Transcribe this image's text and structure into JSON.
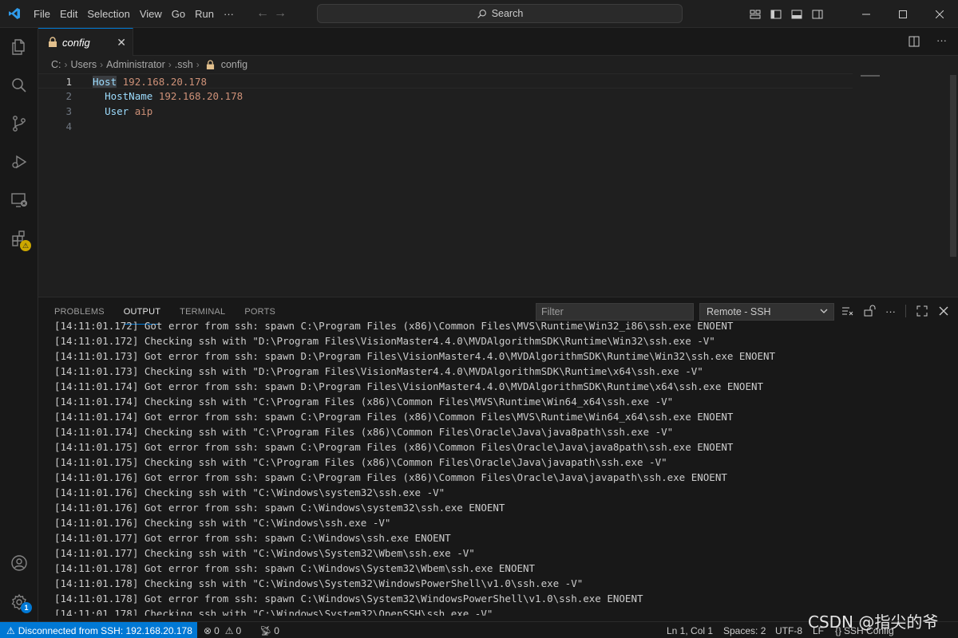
{
  "menu": [
    "File",
    "Edit",
    "Selection",
    "View",
    "Go",
    "Run",
    "···"
  ],
  "search": {
    "placeholder": "Search"
  },
  "tab": {
    "name": "config"
  },
  "breadcrumb": [
    "C:",
    "Users",
    "Administrator",
    ".ssh",
    "config"
  ],
  "editor": {
    "lines": [
      {
        "num": "1",
        "key": "Host",
        "value": "192.168.20.178",
        "indent": ""
      },
      {
        "num": "2",
        "key": "HostName",
        "value": "192.168.20.178",
        "indent": "  "
      },
      {
        "num": "3",
        "key": "User",
        "value": "aip",
        "indent": "  "
      },
      {
        "num": "4",
        "key": "",
        "value": "",
        "indent": ""
      }
    ]
  },
  "panel": {
    "tabs": [
      "PROBLEMS",
      "OUTPUT",
      "TERMINAL",
      "PORTS"
    ],
    "active_tab": "OUTPUT",
    "filter_placeholder": "Filter",
    "channel": "Remote - SSH",
    "log": [
      "[14:11:01.172] Got error from ssh: spawn C:\\Program Files (x86)\\Common Files\\MVS\\Runtime\\Win32_i86\\ssh.exe ENOENT",
      "[14:11:01.172] Checking ssh with \"D:\\Program Files\\VisionMaster4.4.0\\MVDAlgorithmSDK\\Runtime\\Win32\\ssh.exe -V\"",
      "[14:11:01.173] Got error from ssh: spawn D:\\Program Files\\VisionMaster4.4.0\\MVDAlgorithmSDK\\Runtime\\Win32\\ssh.exe ENOENT",
      "[14:11:01.173] Checking ssh with \"D:\\Program Files\\VisionMaster4.4.0\\MVDAlgorithmSDK\\Runtime\\x64\\ssh.exe -V\"",
      "[14:11:01.174] Got error from ssh: spawn D:\\Program Files\\VisionMaster4.4.0\\MVDAlgorithmSDK\\Runtime\\x64\\ssh.exe ENOENT",
      "[14:11:01.174] Checking ssh with \"C:\\Program Files (x86)\\Common Files\\MVS\\Runtime\\Win64_x64\\ssh.exe -V\"",
      "[14:11:01.174] Got error from ssh: spawn C:\\Program Files (x86)\\Common Files\\MVS\\Runtime\\Win64_x64\\ssh.exe ENOENT",
      "[14:11:01.174] Checking ssh with \"C:\\Program Files (x86)\\Common Files\\Oracle\\Java\\java8path\\ssh.exe -V\"",
      "[14:11:01.175] Got error from ssh: spawn C:\\Program Files (x86)\\Common Files\\Oracle\\Java\\java8path\\ssh.exe ENOENT",
      "[14:11:01.175] Checking ssh with \"C:\\Program Files (x86)\\Common Files\\Oracle\\Java\\javapath\\ssh.exe -V\"",
      "[14:11:01.176] Got error from ssh: spawn C:\\Program Files (x86)\\Common Files\\Oracle\\Java\\javapath\\ssh.exe ENOENT",
      "[14:11:01.176] Checking ssh with \"C:\\Windows\\system32\\ssh.exe -V\"",
      "[14:11:01.176] Got error from ssh: spawn C:\\Windows\\system32\\ssh.exe ENOENT",
      "[14:11:01.176] Checking ssh with \"C:\\Windows\\ssh.exe -V\"",
      "[14:11:01.177] Got error from ssh: spawn C:\\Windows\\ssh.exe ENOENT",
      "[14:11:01.177] Checking ssh with \"C:\\Windows\\System32\\Wbem\\ssh.exe -V\"",
      "[14:11:01.178] Got error from ssh: spawn C:\\Windows\\System32\\Wbem\\ssh.exe ENOENT",
      "[14:11:01.178] Checking ssh with \"C:\\Windows\\System32\\WindowsPowerShell\\v1.0\\ssh.exe -V\"",
      "[14:11:01.178] Got error from ssh: spawn C:\\Windows\\System32\\WindowsPowerShell\\v1.0\\ssh.exe ENOENT",
      "[14:11:01.178] Checking ssh with \"C:\\Windows\\System32\\OpenSSH\\ssh.exe -V\""
    ]
  },
  "status": {
    "remote": "Disconnected from SSH: 192.168.20.178",
    "errors": "0",
    "warnings": "0",
    "ports": "0",
    "position": "Ln 1, Col 1",
    "spaces": "Spaces: 2",
    "encoding": "UTF-8",
    "eol": "LF",
    "language": "SSH Config"
  },
  "badges": {
    "settings": "1"
  },
  "watermark": "CSDN @指尖的爷",
  "colors": {
    "accent": "#0078d4",
    "keyword": "#9cdcfe",
    "string": "#ce9178",
    "warning": "#cca700"
  }
}
